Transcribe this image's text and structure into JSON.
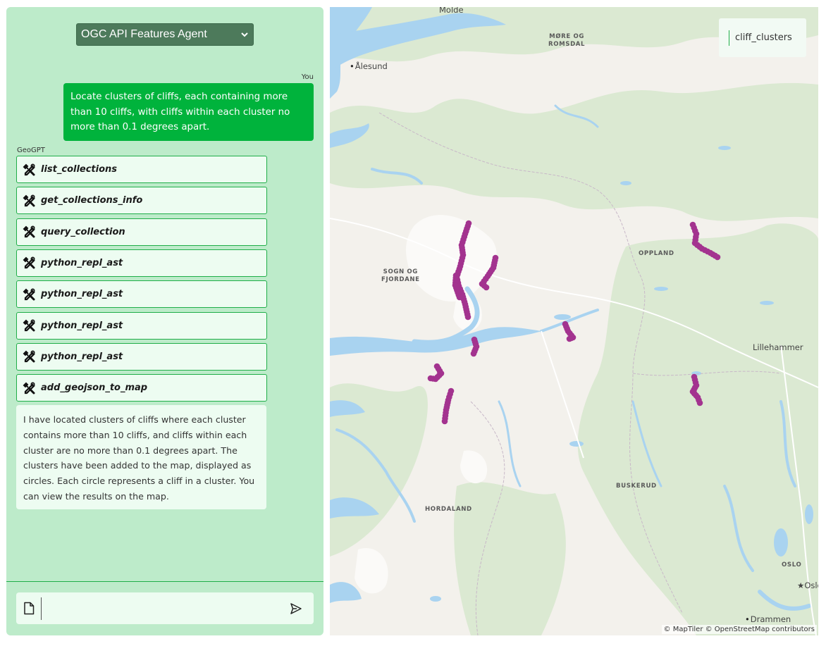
{
  "header": {
    "agent_select_value": "OGC API Features Agent"
  },
  "chat": {
    "user_label": "You",
    "assistant_label": "GeoGPT",
    "user_message": "Locate clusters of cliffs, each containing more than 10 cliffs, with cliffs within each cluster no more than 0.1 degrees apart.",
    "tool_calls": [
      {
        "label": "list_collections",
        "icon": "tools-icon"
      },
      {
        "label": "get_collections_info",
        "icon": "tools-icon"
      },
      {
        "label": "query_collection",
        "icon": "tools-icon"
      },
      {
        "label": "python_repl_ast",
        "icon": "tools-icon"
      },
      {
        "label": "python_repl_ast",
        "icon": "tools-icon"
      },
      {
        "label": "python_repl_ast",
        "icon": "tools-icon"
      },
      {
        "label": "python_repl_ast",
        "icon": "tools-icon"
      },
      {
        "label": "add_geojson_to_map",
        "icon": "tools-icon"
      }
    ],
    "assistant_message": "I have located clusters of cliffs where each cluster contains more than 10 cliffs, and cliffs within each cluster are no more than 0.1 degrees apart. The clusters have been added to the map, displayed as circles. Each circle represents a cliff in a cluster. You can view the results on the map.",
    "input_value": "",
    "attach_icon": "file-icon",
    "send_icon": "send-icon"
  },
  "map": {
    "layer_name": "cliff_clusters",
    "attribution": "© MapTiler © OpenStreetMap contributors",
    "cluster_color": "#a3338f",
    "water_color": "#a9d3f0",
    "forest_color": "#dbe9d2",
    "labels": {
      "molde": "Molde",
      "more_og_romsdal": "MØRE OG\nROMSDAL",
      "alesund": "Ålesund",
      "sogn_og_fjordane": "SOGN OG\nFJORDANE",
      "oppland": "OPPLAND",
      "lillehammer": "Lillehammer",
      "buskerud": "BUSKERUD",
      "hordaland": "HORDALAND",
      "oslo_region": "OSLO",
      "oslo": "Oslo",
      "drammen": "Drammen"
    }
  },
  "colors": {
    "panel_bg": "#bdebca",
    "user_bubble": "#00b33c",
    "select_bg": "#4d7a5b",
    "tool_border": "#1fae48"
  }
}
